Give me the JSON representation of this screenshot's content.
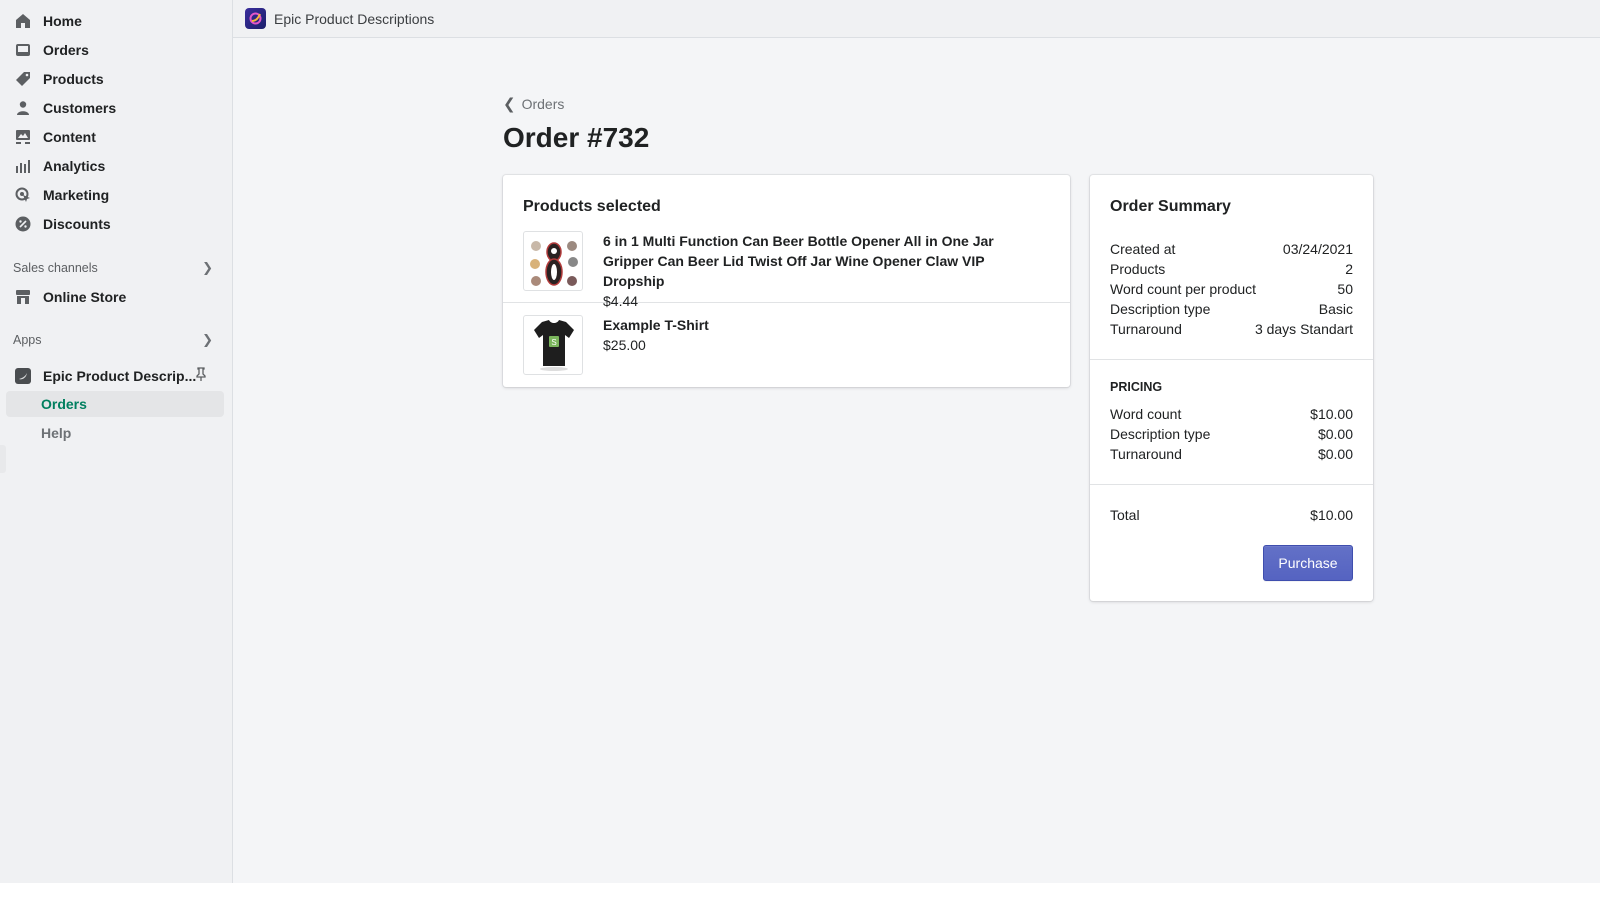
{
  "sidebar": {
    "nav": [
      {
        "label": "Home",
        "icon": "home-icon"
      },
      {
        "label": "Orders",
        "icon": "orders-icon"
      },
      {
        "label": "Products",
        "icon": "tag-icon"
      },
      {
        "label": "Customers",
        "icon": "person-icon"
      },
      {
        "label": "Content",
        "icon": "content-icon"
      },
      {
        "label": "Analytics",
        "icon": "bar-chart-icon"
      },
      {
        "label": "Marketing",
        "icon": "marketing-icon"
      },
      {
        "label": "Discounts",
        "icon": "discount-icon"
      }
    ],
    "sales_channels": {
      "label": "Sales channels",
      "items": [
        {
          "label": "Online Store",
          "icon": "store-icon"
        }
      ]
    },
    "apps": {
      "label": "Apps",
      "app_name": "Epic Product Descrip...",
      "sub_items": [
        {
          "label": "Orders",
          "active": true
        },
        {
          "label": "Help",
          "active": false
        }
      ]
    }
  },
  "topbar": {
    "app_title": "Epic Product Descriptions"
  },
  "main": {
    "breadcrumb": "Orders",
    "title": "Order #732",
    "products_card": {
      "title": "Products selected",
      "items": [
        {
          "name": "6 in 1 Multi Function Can Beer Bottle Opener All in One Jar Gripper Can Beer Lid Twist Off Jar Wine Opener Claw VIP Dropship",
          "price": "$4.44"
        },
        {
          "name": "Example T-Shirt",
          "price": "$25.00"
        }
      ]
    },
    "summary_card": {
      "title": "Order Summary",
      "details": [
        {
          "label": "Created at",
          "value": "03/24/2021"
        },
        {
          "label": "Products",
          "value": "2"
        },
        {
          "label": "Word count per product",
          "value": "50"
        },
        {
          "label": "Description type",
          "value": "Basic"
        },
        {
          "label": "Turnaround",
          "value": "3 days Standart"
        }
      ],
      "pricing_heading": "PRICING",
      "pricing": [
        {
          "label": "Word count",
          "value": "$10.00"
        },
        {
          "label": "Description type",
          "value": "$0.00"
        },
        {
          "label": "Turnaround",
          "value": "$0.00"
        }
      ],
      "total_label": "Total",
      "total_value": "$10.00",
      "purchase_label": "Purchase"
    }
  },
  "colors": {
    "accent": "#5c6ac4",
    "active_nav": "#007f5f"
  }
}
